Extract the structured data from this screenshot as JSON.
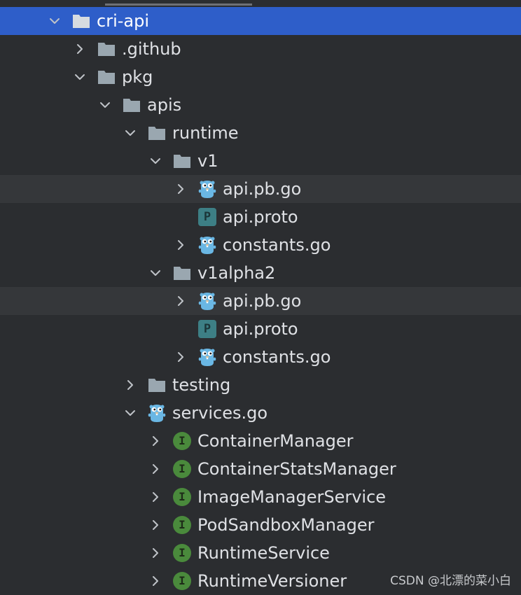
{
  "tree": {
    "items": [
      {
        "label": "cri-api",
        "kind": "folder",
        "chevron": "down",
        "selected": true
      },
      {
        "label": ".github",
        "kind": "folder",
        "chevron": "right"
      },
      {
        "label": "pkg",
        "kind": "folder",
        "chevron": "down"
      },
      {
        "label": "apis",
        "kind": "folder",
        "chevron": "down"
      },
      {
        "label": "runtime",
        "kind": "folder",
        "chevron": "down"
      },
      {
        "label": "v1",
        "kind": "folder",
        "chevron": "down"
      },
      {
        "label": "api.pb.go",
        "kind": "gofile",
        "chevron": "right",
        "hover": true
      },
      {
        "label": "api.proto",
        "kind": "proto",
        "chevron": "none"
      },
      {
        "label": "constants.go",
        "kind": "gofile",
        "chevron": "right"
      },
      {
        "label": "v1alpha2",
        "kind": "folder",
        "chevron": "down"
      },
      {
        "label": "api.pb.go",
        "kind": "gofile",
        "chevron": "right",
        "hover": true
      },
      {
        "label": "api.proto",
        "kind": "proto",
        "chevron": "none"
      },
      {
        "label": "constants.go",
        "kind": "gofile",
        "chevron": "right"
      },
      {
        "label": "testing",
        "kind": "folder",
        "chevron": "right"
      },
      {
        "label": "services.go",
        "kind": "gofile",
        "chevron": "down"
      },
      {
        "label": "ContainerManager",
        "kind": "interface",
        "chevron": "right"
      },
      {
        "label": "ContainerStatsManager",
        "kind": "interface",
        "chevron": "right"
      },
      {
        "label": "ImageManagerService",
        "kind": "interface",
        "chevron": "right"
      },
      {
        "label": "PodSandboxManager",
        "kind": "interface",
        "chevron": "right"
      },
      {
        "label": "RuntimeService",
        "kind": "interface",
        "chevron": "right"
      },
      {
        "label": "RuntimeVersioner",
        "kind": "interface",
        "chevron": "right"
      }
    ],
    "interface_badge": "I",
    "proto_badge": "P"
  },
  "watermark": "CSDN @北漂的菜小白",
  "colors": {
    "background": "#2b2d30",
    "selection": "#2e5ec9",
    "hover": "#35373a",
    "folder": "#9aa7b0",
    "interface": "#4a8a3c",
    "proto": "#3d7f85",
    "gopher": "#6ab7e4"
  }
}
